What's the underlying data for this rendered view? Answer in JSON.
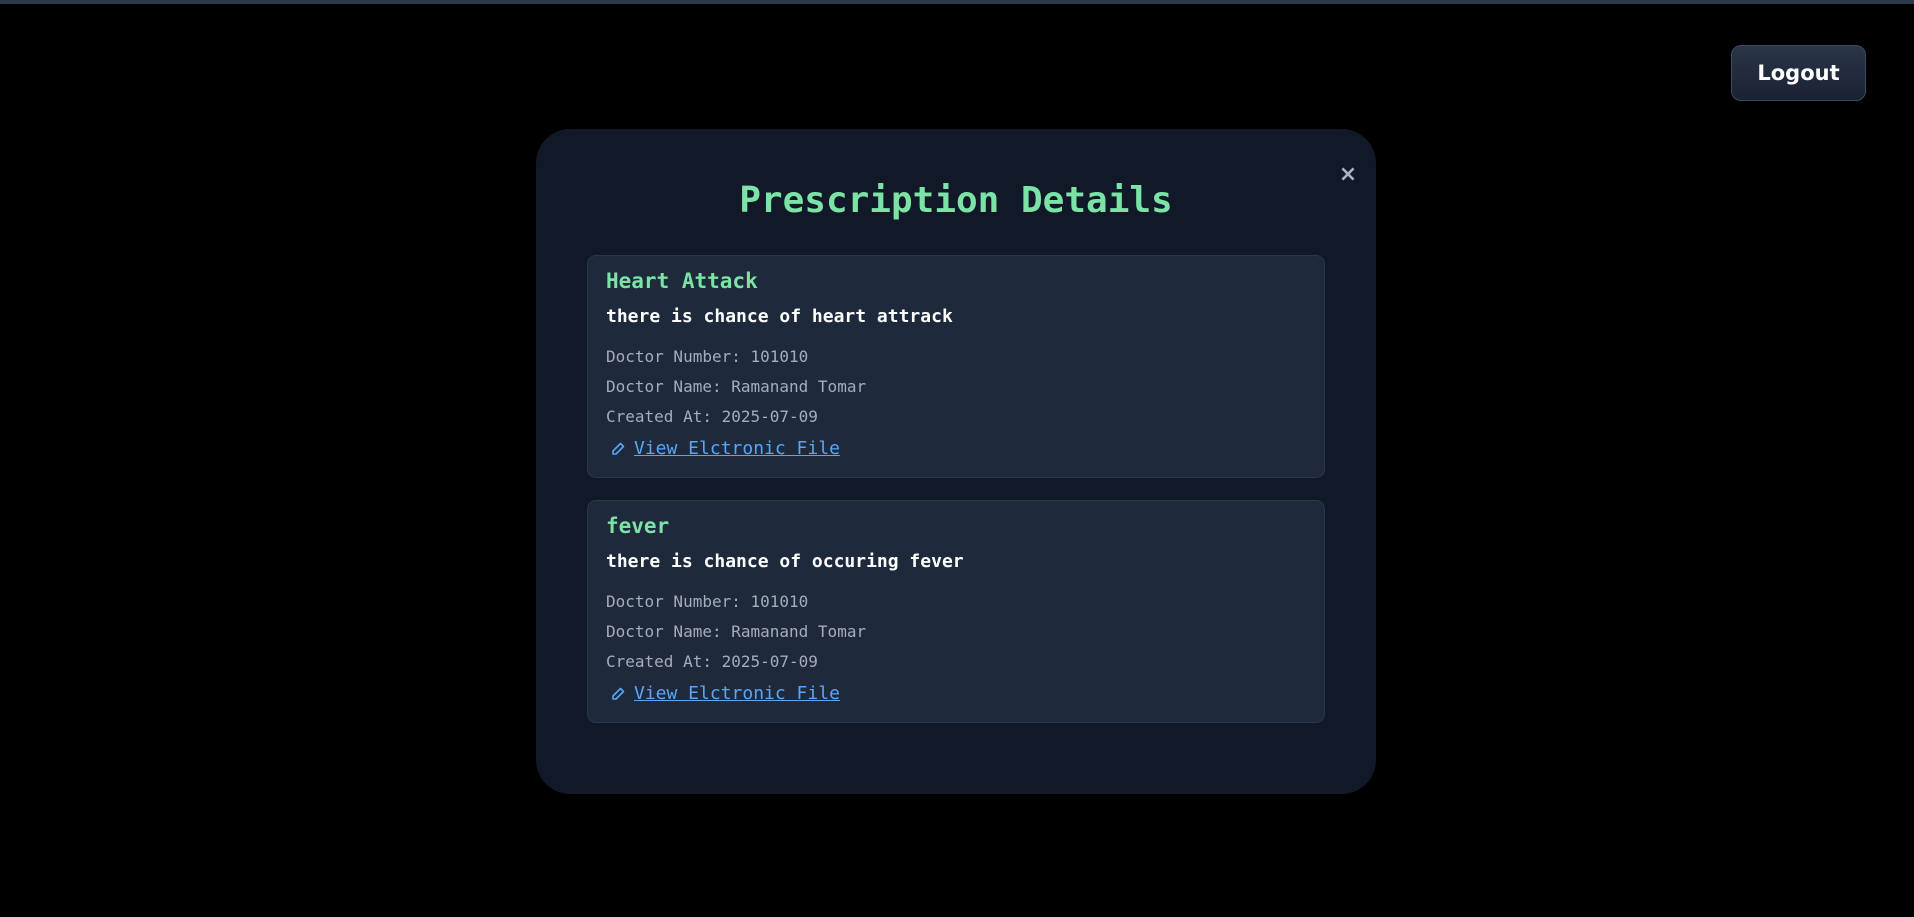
{
  "header": {
    "logout_label": "Logout"
  },
  "modal": {
    "title": "Prescription Details",
    "close_label": "×",
    "prescriptions": [
      {
        "title": "Heart Attack",
        "description": "there is chance of heart attrack",
        "doctor_number": "Doctor Number: 101010",
        "doctor_name": "Doctor Name: Ramanand Tomar",
        "created_at": "Created At: 2025-07-09",
        "file_link_label": "View Elctronic File"
      },
      {
        "title": "fever",
        "description": "there is chance of occuring fever",
        "doctor_number": "Doctor Number: 101010",
        "doctor_name": "Doctor Name: Ramanand Tomar",
        "created_at": "Created At: 2025-07-09",
        "file_link_label": "View Elctronic File"
      }
    ]
  },
  "icons": {
    "file_link_icon": "paperclip-icon",
    "close_icon": "close-icon"
  },
  "colors": {
    "background": "#000000",
    "modal": "#111827",
    "card": "#1e293b",
    "accent_green": "#7be3a5",
    "link_blue": "#5aa6f5",
    "meta_gray": "#a3adbb"
  }
}
